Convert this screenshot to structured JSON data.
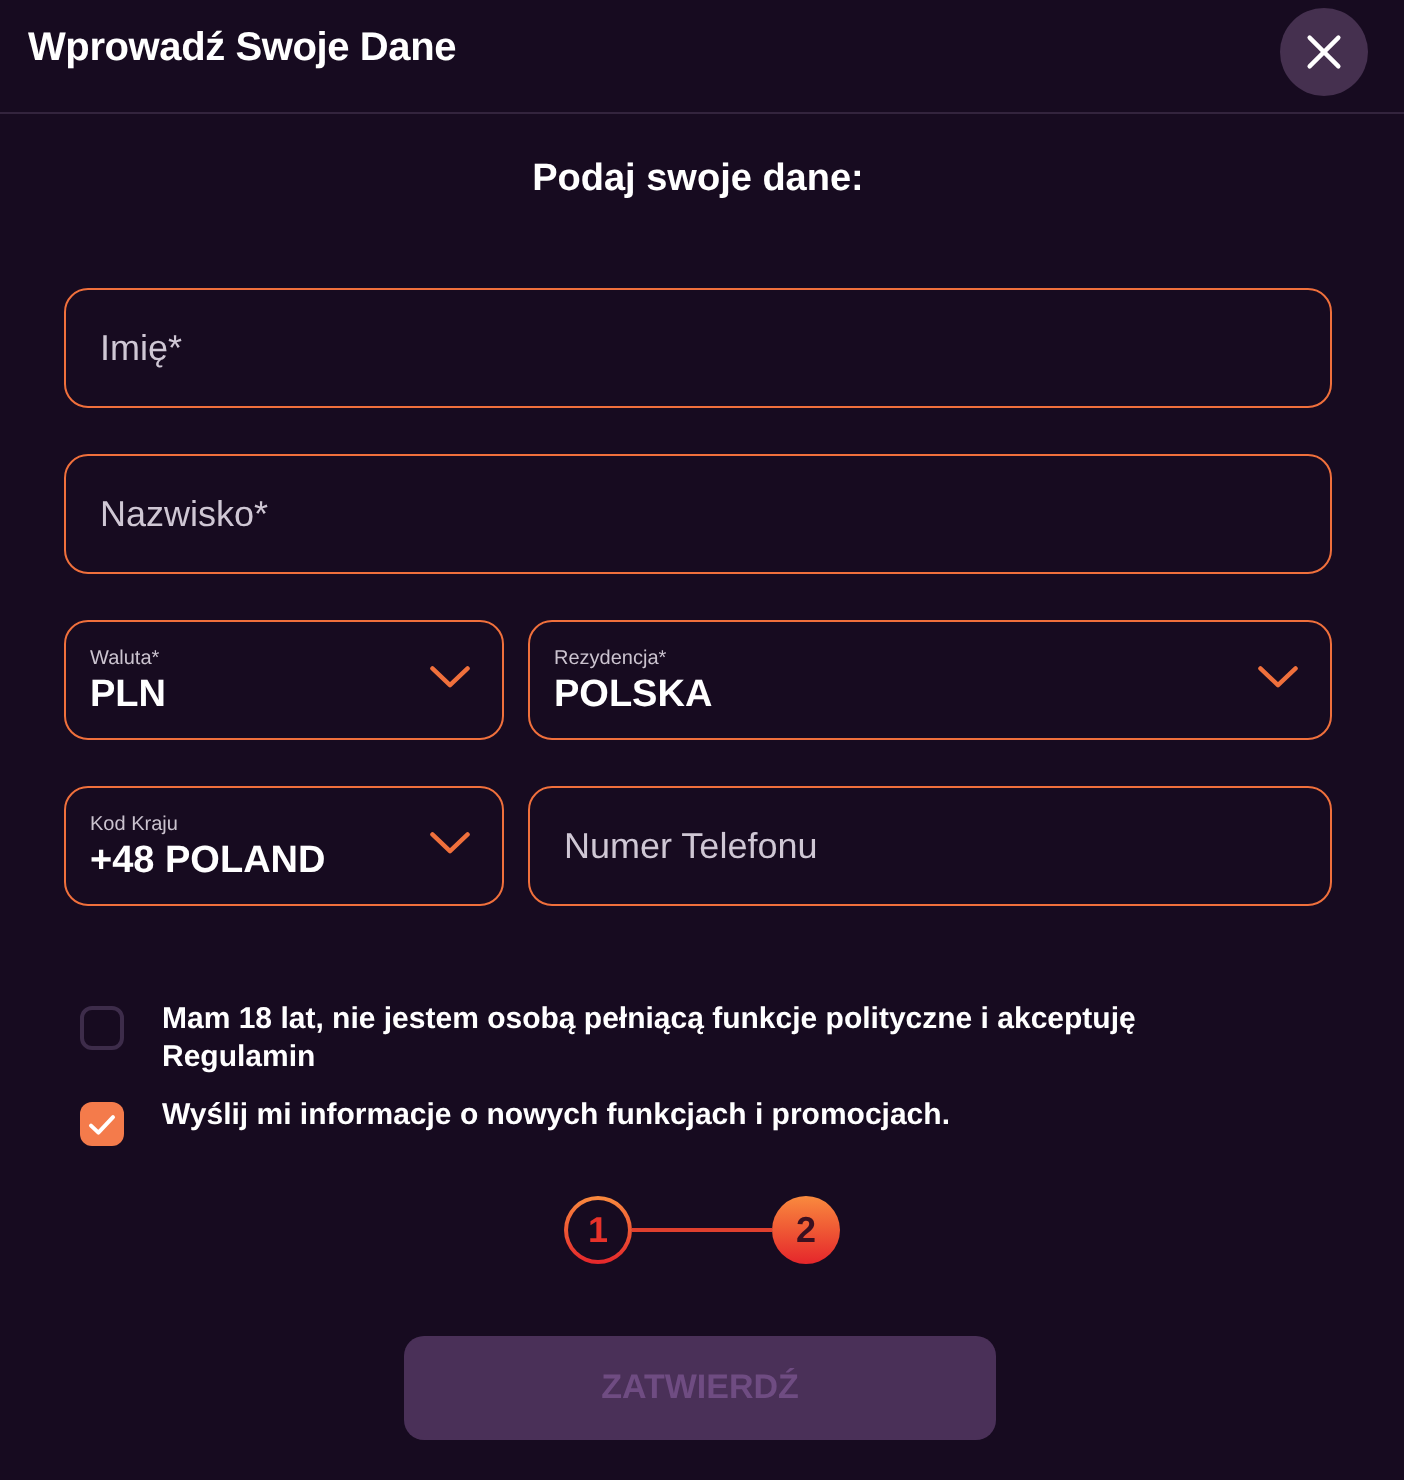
{
  "header": {
    "title": "Wprowadź Swoje Dane"
  },
  "form": {
    "heading": "Podaj swoje dane:",
    "rows": [
      {
        "fields": [
          {
            "kind": "text",
            "placeholder": "Imię*"
          }
        ]
      },
      {
        "fields": [
          {
            "kind": "text",
            "placeholder": "Nazwisko*"
          }
        ]
      },
      {
        "fields": [
          {
            "kind": "select",
            "label": "Waluta*",
            "value": "PLN"
          },
          {
            "kind": "select",
            "label": "Rezydencja*",
            "value": "POLSKA"
          }
        ]
      },
      {
        "fields": [
          {
            "kind": "select",
            "label": "Kod Kraju",
            "value": "+48 POLAND"
          },
          {
            "kind": "text",
            "placeholder": "Numer Telefonu"
          }
        ]
      }
    ]
  },
  "consents": [
    {
      "text": "Mam 18 lat, nie jestem osobą pełniącą funkcje polityczne i akceptuję Regulamin",
      "checked": false
    },
    {
      "text": "Wyślij mi informacje o nowych funkcjach i promocjach.",
      "checked": true
    }
  ],
  "steps": [
    {
      "label": "1",
      "selected": false
    },
    {
      "label": "2",
      "selected": true
    }
  ],
  "submit": {
    "label": "ZATWIERDŹ",
    "disabled": true
  }
}
